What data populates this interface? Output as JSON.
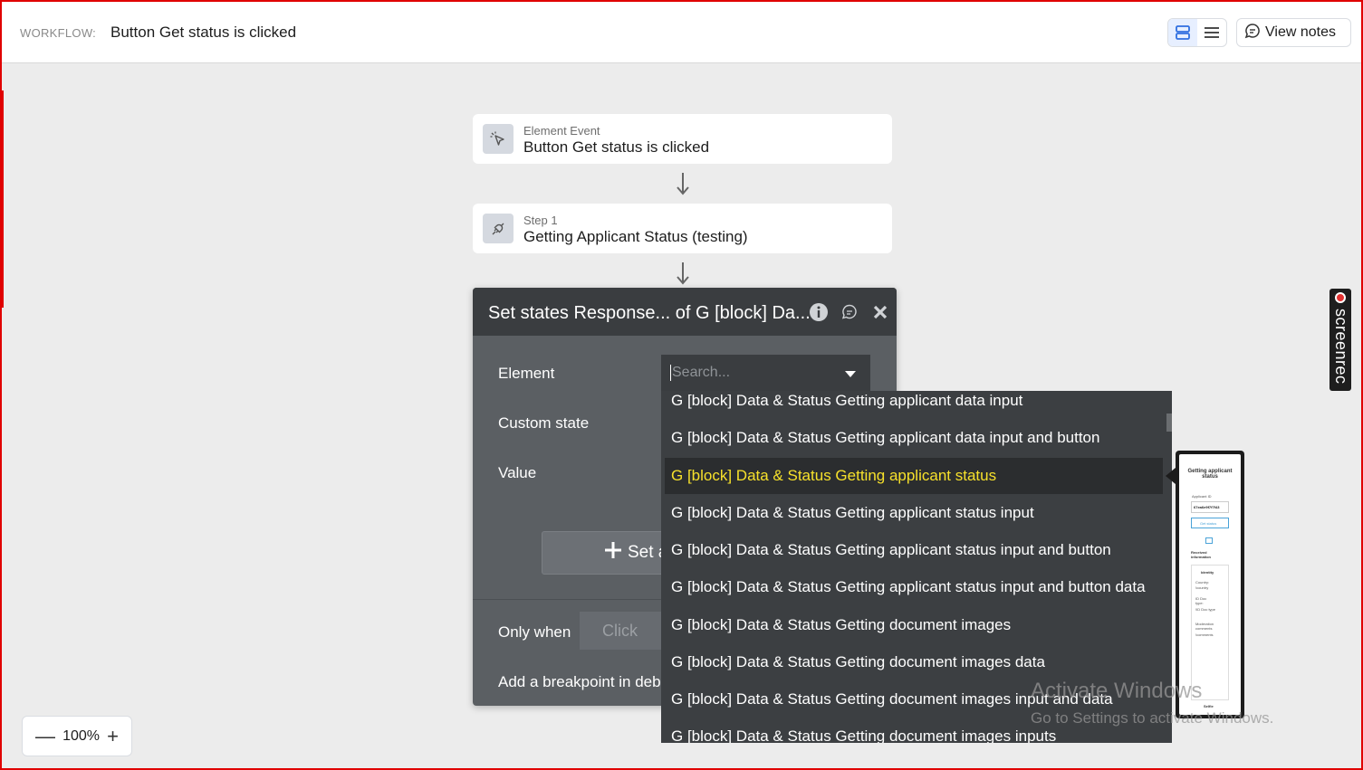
{
  "header": {
    "workflow_label": "WORKFLOW:",
    "workflow_title": "Button Get status is clicked",
    "view_notes_label": "View notes"
  },
  "event_card": {
    "subtitle": "Element Event",
    "title": "Button Get status is clicked"
  },
  "step_card": {
    "subtitle": "Step 1",
    "title": "Getting Applicant Status (testing)"
  },
  "modal": {
    "title": "Set states Response... of G [block] Da...",
    "element_label": "Element",
    "custom_state_label": "Custom state",
    "value_label": "Value",
    "search_placeholder": "Search...",
    "set_button_label": "Set a",
    "only_when_label": "Only when",
    "only_when_placeholder": "Click",
    "breakpoint_label": "Add a breakpoint in deb"
  },
  "dropdown": {
    "items": [
      "G [block] Data & Status Getting applicant data input",
      "G [block] Data & Status Getting applicant data input and button",
      "G [block] Data & Status Getting applicant status",
      "G [block] Data & Status Getting applicant status input",
      "G [block] Data & Status Getting applicant status input and button",
      "G [block] Data & Status Getting applicant status input and button data",
      "G [block] Data & Status Getting document images",
      "G [block] Data & Status Getting document images data",
      "G [block] Data & Status Getting document images input and data",
      "G [block] Data & Status Getting document images inputs"
    ],
    "selected": "G [block] Data & Status Getting applicant status",
    "selected_color": "#f7e12b"
  },
  "preview": {
    "title": "Getting applicant status",
    "applicant_id_label": "Applicant ID",
    "applicant_id_value": "67ea6e9f7f7f43",
    "button_label": "Get status",
    "section_label": "Received information",
    "identity_label": "Identity",
    "country_label": "Country:",
    "country_value": "!country",
    "id_doc_label": "ID Doc type:",
    "id_doc_value": "!ID Doc type",
    "moderation_label": "Moderation comments",
    "moderation_value": "!comments",
    "footer_label": "Selfie"
  },
  "screenrec": {
    "label": "screenrec"
  },
  "zoom": {
    "level": "100%",
    "minus": "—",
    "plus": "+"
  },
  "watermark": {
    "line1": "Activate Windows",
    "line2": "Go to Settings to activate Windows."
  },
  "colors": {
    "frame_border": "#e00000",
    "modal_bg": "#5b5f63",
    "modal_header": "#3a3d40",
    "dropdown_bg": "#3c3f42",
    "accent_blue": "#2f6fe0"
  },
  "icons": {
    "view_toggle_cards": "cards-view-icon",
    "view_toggle_list": "list-view-icon",
    "notes": "notes-icon",
    "event": "cursor-click-icon",
    "step": "plug-icon",
    "info": "info-icon",
    "comment": "comment-icon",
    "close": "close-icon",
    "plus": "plus-icon"
  }
}
